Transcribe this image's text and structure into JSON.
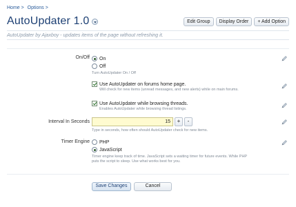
{
  "breadcrumb": {
    "home": "Home >",
    "options": "Options >"
  },
  "page": {
    "title": "AutoUpdater 1.0",
    "subtitle": "AutoUpdater by Ajaxboy - updates items of the page without refreshing it."
  },
  "actions": {
    "edit_group": "Edit Group",
    "display_order": "Display Order",
    "add_option": "+ Add Option"
  },
  "onoff": {
    "label": "On/Off",
    "on_label": "On",
    "off_label": "Off",
    "selected": "On",
    "help": "Turn AutoUpdater On / Off"
  },
  "forums_home": {
    "label": "Use AutoUpdater on forums home page.",
    "checked": true,
    "help": "Will check for new items (unread messages, and new alerts) while on main forums."
  },
  "browsing_threads": {
    "label": "Use AutoUpdater while browsing threads.",
    "checked": true,
    "help": "Enables AutoUpdater while browsing thread listings."
  },
  "interval": {
    "label": "Interval In Seconds",
    "value": "15",
    "plus": "+",
    "minus": "-",
    "help": "Type in seconds, how often should AutoUpdater check for new items."
  },
  "timer_engine": {
    "label": "Timer Engine",
    "php_label": "PHP",
    "js_label": "JavaScript",
    "selected": "JavaScript",
    "help_line1": "Timer engine keep track of time. JavaScript sets a waiting timer for future events. While PHP",
    "help_line2": "puts the script to sleep. Use what works best for you."
  },
  "footer": {
    "save": "Save Changes",
    "cancel": "Cancel"
  },
  "icons": {
    "edit": "pencil-icon"
  },
  "colors": {
    "accent": "#1c3f73",
    "link": "#2b5d9b",
    "input_bg": "#fffbd0"
  }
}
